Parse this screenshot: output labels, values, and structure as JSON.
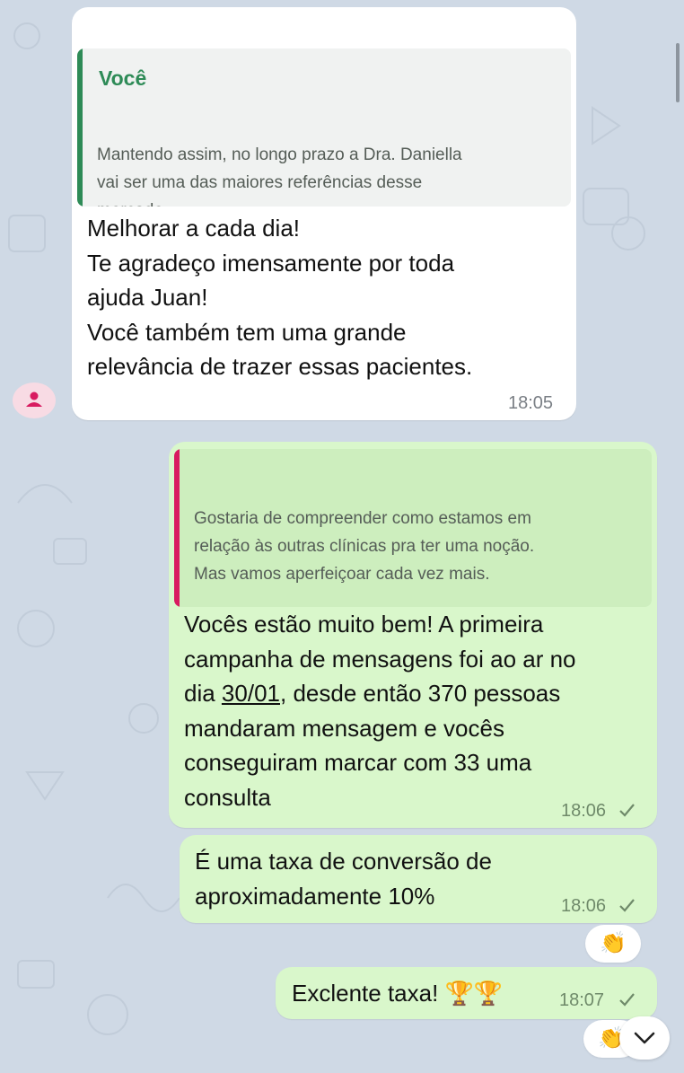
{
  "messages": [
    {
      "quote_author": "Você",
      "quote_text": "Mantendo assim, no longo prazo a Dra. Daniella\nvai ser uma das maiores referências desse\nmercado",
      "text": "Melhorar a cada dia!\nTe agradeço imensamente por toda\najuda Juan!\nVocê também tem uma grande\nrelevância de trazer essas pacientes.",
      "time": "18:05"
    },
    {
      "quote_text": "Gostaria de compreender como estamos em\nrelação às outras clínicas pra ter uma noção.\nMas vamos aperfeiçoar cada vez mais.",
      "text_before_date": "Vocês estão muito bem! A primeira\ncampanha de mensagens foi ao ar no\ndia ",
      "date": "30/01",
      "text_after_date": ", desde então 370 pessoas\nmandaram mensagem e vocês\nconseguiram marcar com 33 uma\nconsulta",
      "time": "18:06"
    },
    {
      "text": "É uma taxa de conversão de\naproximadamente 10%",
      "time": "18:06",
      "reaction": "👏"
    },
    {
      "text": "Exclente taxa! 🏆🏆",
      "time": "18:07",
      "reaction": "👏"
    }
  ],
  "icons": {
    "avatar": "person-icon",
    "read_receipt": "check-icon",
    "scroll_down": "chevron-down-icon"
  },
  "colors": {
    "background": "#cfd9e5",
    "incoming_bubble": "#ffffff",
    "outgoing_bubble": "#d9f7cb",
    "quote_bar_incoming": "#2e8b57",
    "quote_bar_outgoing": "#d81b60",
    "avatar": "#d81b60"
  }
}
